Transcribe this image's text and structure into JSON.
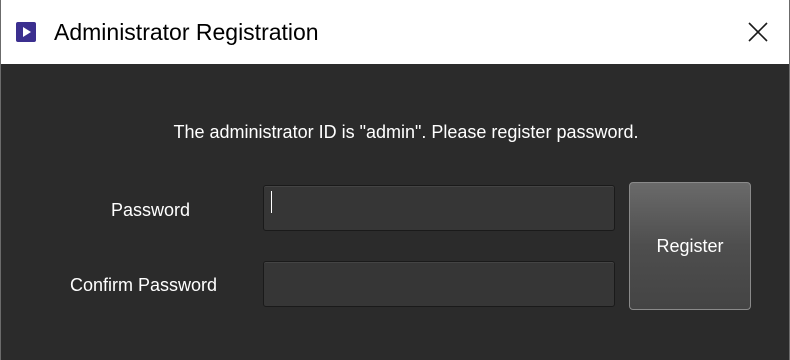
{
  "window": {
    "title": "Administrator Registration",
    "app_icon": "play-icon",
    "close_icon": "close-icon"
  },
  "dialog": {
    "message": "The administrator ID is \"admin\". Please register password.",
    "password_label": "Password",
    "password_value": "",
    "confirm_label": "Confirm Password",
    "confirm_value": "",
    "register_label": "Register"
  },
  "colors": {
    "content_bg": "#2b2b2b",
    "icon_bg": "#3b2f8f",
    "text": "#ffffff"
  }
}
